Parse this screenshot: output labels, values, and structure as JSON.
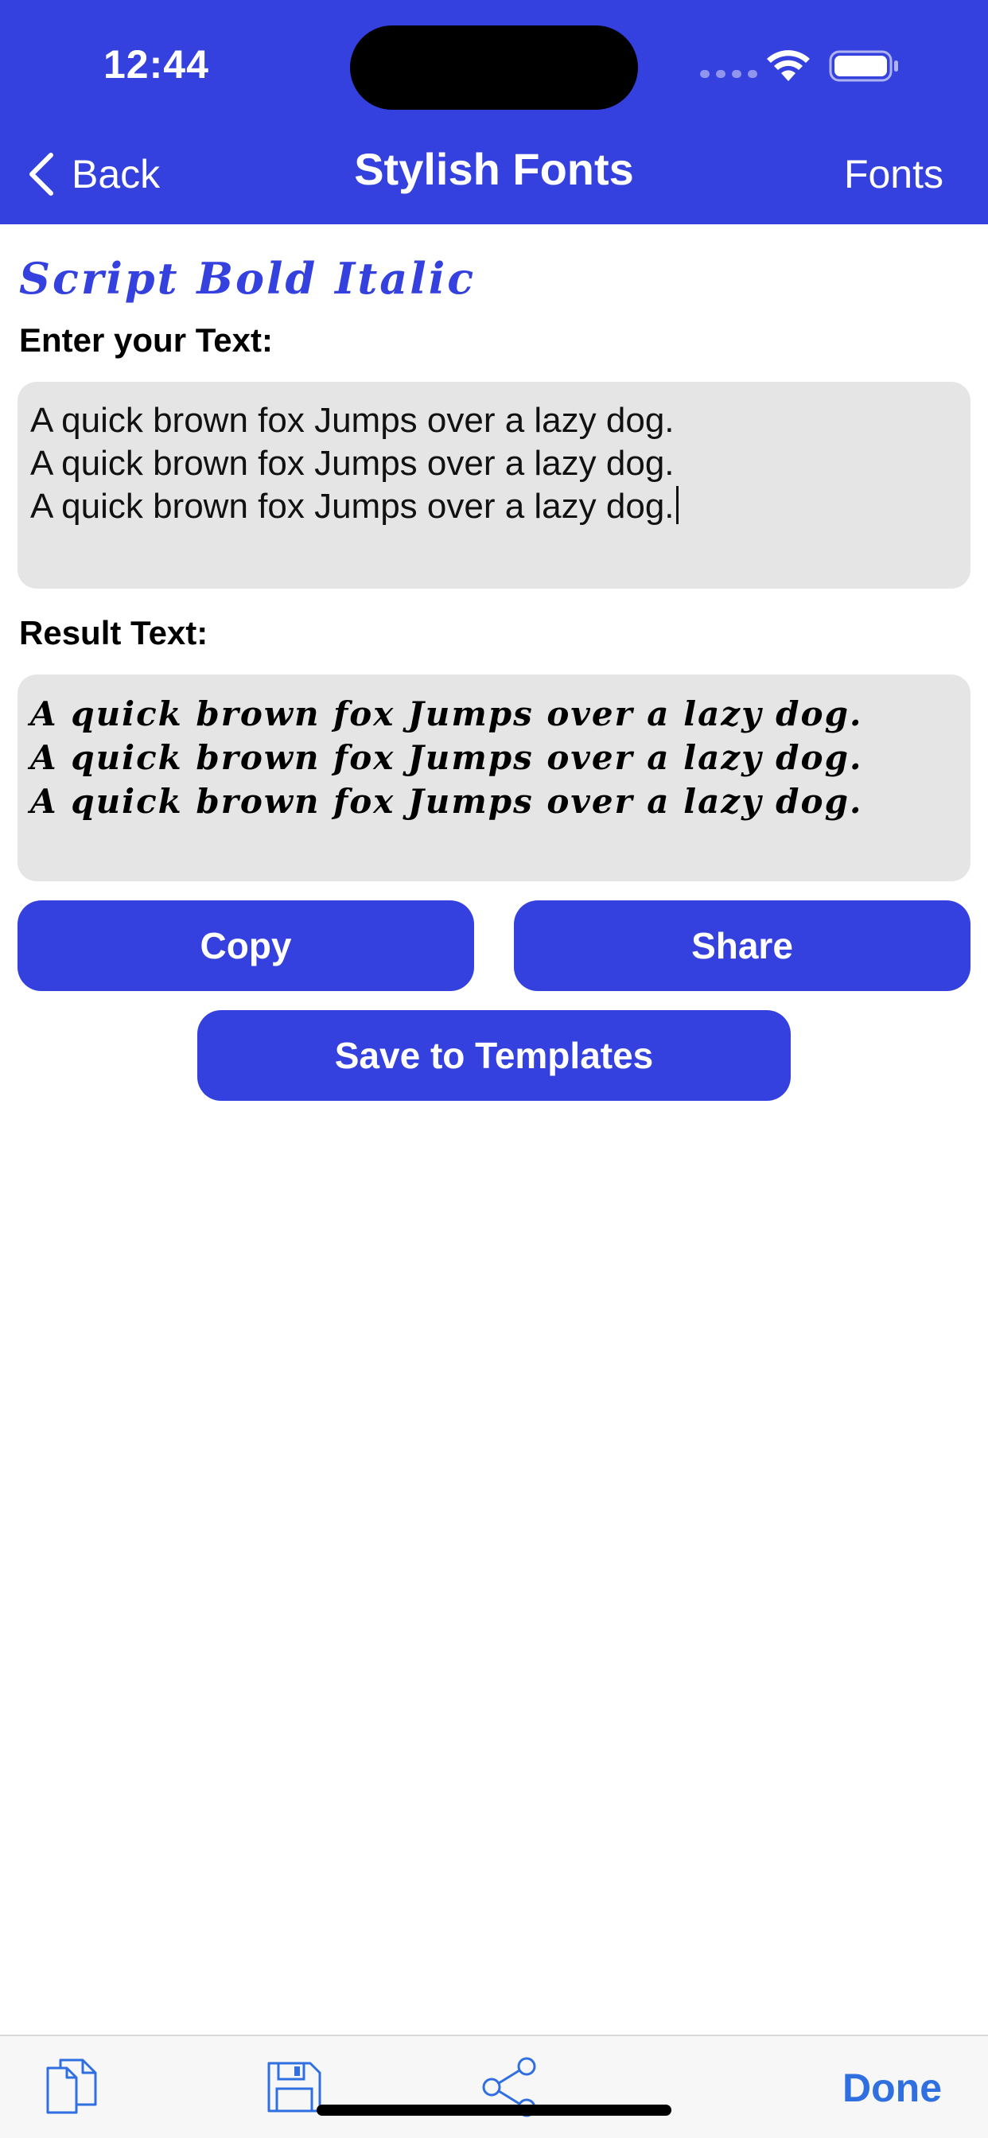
{
  "status_bar": {
    "time": "12:44",
    "icons": [
      "signal-icon",
      "wifi-icon",
      "battery-icon"
    ]
  },
  "nav": {
    "back_label": "Back",
    "title": "Stylish Fonts",
    "right_label": "Fonts"
  },
  "font_name": "Script Bold Italic",
  "input": {
    "label": "Enter your Text:",
    "lines": [
      "A quick brown fox Jumps over a lazy dog.",
      "A quick brown fox Jumps over a lazy dog.",
      "A quick brown fox Jumps over a lazy dog."
    ]
  },
  "result": {
    "label": "Result Text:",
    "lines": [
      "A quick brown fox Jumps over a lazy dog.",
      "A quick brown fox Jumps over a lazy dog.",
      "A quick brown fox Jumps over a lazy dog."
    ]
  },
  "buttons": {
    "copy": "Copy",
    "share": "Share",
    "save": "Save to Templates"
  },
  "toolbar": {
    "icons": [
      "documents-icon",
      "save-disk-icon",
      "share-icon"
    ],
    "done_label": "Done"
  },
  "colors": {
    "accent": "#3541DE",
    "field_bg": "#E5E5E5",
    "toolbar_done": "#2F6FE0"
  }
}
